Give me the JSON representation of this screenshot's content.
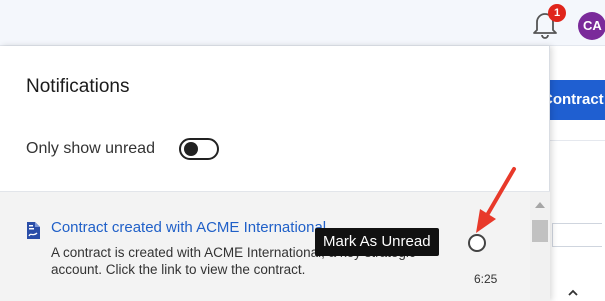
{
  "header": {
    "notification_count": "1",
    "avatar_initials": "CA"
  },
  "background": {
    "primary_button_label": "Contract"
  },
  "notifications_panel": {
    "title": "Notifications",
    "only_show_unread_label": "Only show unread",
    "only_show_unread_enabled": false,
    "items": [
      {
        "title": "Contract created with ACME International",
        "body": "A contract is created with ACME International, a key strategic account. Click the link to view the contract.",
        "time": "6:25",
        "icon": "document-icon"
      }
    ],
    "tooltip": "Mark As Unread"
  },
  "colors": {
    "link_blue": "#2060c8",
    "badge_red": "#e0251b",
    "avatar_purple": "#7a2a9a",
    "annotation_arrow": "#e8392a"
  }
}
